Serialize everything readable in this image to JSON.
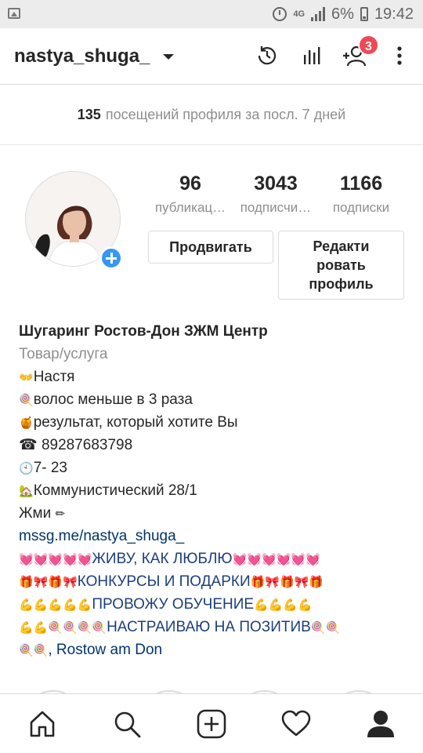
{
  "status_bar": {
    "network": "4G",
    "battery": "6%",
    "time": "19:42"
  },
  "header": {
    "username": "nastya_shuga_",
    "notification_count": "3",
    "icons": [
      "history-icon",
      "insights-icon",
      "discover-people-icon",
      "more-options-icon"
    ]
  },
  "visits": {
    "count": "135",
    "text": "посещений профиля за посл. 7 дней"
  },
  "profile": {
    "stats": [
      {
        "value": "96",
        "label": "публикац…"
      },
      {
        "value": "3043",
        "label": "подписчи…"
      },
      {
        "value": "1166",
        "label": "подписки"
      }
    ],
    "promote_label": "Продвигать",
    "edit_label_line1": "Редакти",
    "edit_label_line2": "ровать",
    "edit_label_line3": "профиль"
  },
  "bio": {
    "name": "Шугаринг Ростов-Дон ЗЖМ Центр",
    "category": "Товар/услуга",
    "line1": "Настя",
    "line2": "волос меньше в 3 раза",
    "line3": "результат, который хотите Вы",
    "line4": "☎ 89287683798",
    "line5": "7-  23",
    "line6": "Коммунистический 28/1",
    "line7": "Жми",
    "link": "mssg.me/nastya_shuga_",
    "line8": "ЖИВУ, КАК ЛЮБЛЮ",
    "line9": "КОНКУРСЫ И ПОДАРКИ",
    "line10": "ПРОВОЖУ ОБУЧЕНИЕ",
    "line11": "НАСТРАИВАЮ НА ПОЗИТИВ",
    "location": ", Rostow am Don"
  },
  "colors": {
    "accent_blue": "#3897f0",
    "badge_red": "#ed4956",
    "link_blue": "#003569",
    "muted": "#8e8e8e"
  },
  "bottom_nav": [
    "home-icon",
    "search-icon",
    "add-post-icon",
    "activity-heart-icon",
    "profile-icon"
  ]
}
